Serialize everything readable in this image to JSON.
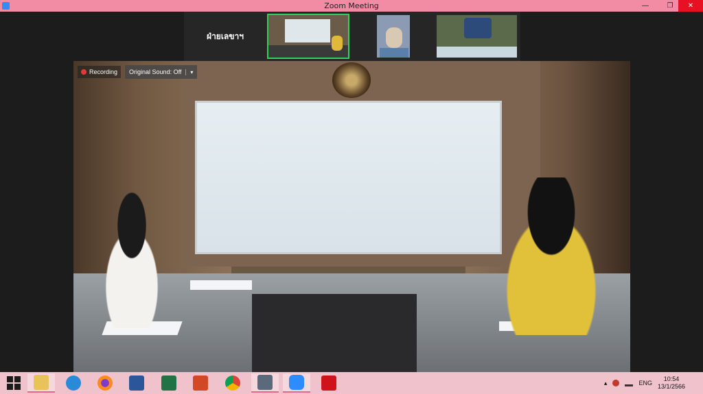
{
  "window": {
    "title": "Zoom Meeting",
    "minimize_glyph": "—",
    "restore_glyph": "❐",
    "close_glyph": "✕"
  },
  "gallery": {
    "active_speaker_label": "ฝ่ายเลขาฯ"
  },
  "video_overlay": {
    "recording_label": "Recording",
    "original_sound_label": "Original Sound: Off",
    "caret_glyph": "▾"
  },
  "taskbar": {
    "apps": [
      "start-icon",
      "file-explorer-icon",
      "internet-explorer-icon",
      "firefox-icon",
      "word-icon",
      "excel-icon",
      "powerpoint-icon",
      "chrome-icon",
      "contacts-icon",
      "zoom-icon",
      "acrobat-icon"
    ],
    "tray": {
      "caret_glyph": "▴",
      "language": "ENG",
      "time": "10:54",
      "date": "13/1/2566"
    }
  },
  "colors": {
    "titlebar": "#f28ba4",
    "taskbar": "#f0c3cc",
    "active_speaker_border": "#2fd25b",
    "recording_dot": "#e23a3a"
  }
}
